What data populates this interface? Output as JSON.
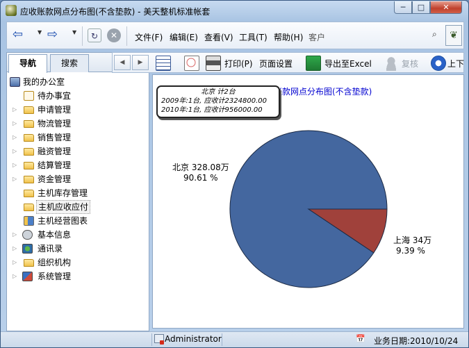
{
  "window": {
    "title": "应收账款网点分布图(不含垫款) - 美天整机标准帐套",
    "minimize_glyph": "─",
    "maximize_glyph": "□",
    "close_glyph": "✕"
  },
  "toolbar": {
    "menus": [
      {
        "label": "文件(F)"
      },
      {
        "label": "编辑(E)"
      },
      {
        "label": "查看(V)"
      },
      {
        "label": "工具(T)"
      },
      {
        "label": "帮助(H)"
      }
    ],
    "customer_label": "客户",
    "icons": {
      "back": "back-arrow-icon",
      "forward": "forward-arrow-icon",
      "refresh": "refresh-icon",
      "stop": "stop-icon",
      "search": "search-icon",
      "logo": "logo-icon"
    }
  },
  "left_panel": {
    "tabs": [
      {
        "label": "导航",
        "active": true
      },
      {
        "label": "搜索",
        "active": false
      }
    ],
    "tree": [
      {
        "label": "我的办公室",
        "level": 0,
        "icon": "office-icon",
        "expander": false
      },
      {
        "label": "待办事宜",
        "level": 1,
        "icon": "todo-icon",
        "expander": false
      },
      {
        "label": "申请管理",
        "level": 1,
        "icon": "folder-icon",
        "expander": true
      },
      {
        "label": "物流管理",
        "level": 1,
        "icon": "folder-icon",
        "expander": true
      },
      {
        "label": "销售管理",
        "level": 1,
        "icon": "folder-icon",
        "expander": true
      },
      {
        "label": "融资管理",
        "level": 1,
        "icon": "folder-icon",
        "expander": true
      },
      {
        "label": "结算管理",
        "level": 1,
        "icon": "folder-icon",
        "expander": true
      },
      {
        "label": "资金管理",
        "level": 1,
        "icon": "folder-icon",
        "expander": true
      },
      {
        "label": "主机库存管理",
        "level": 1,
        "icon": "folder-icon",
        "expander": false
      },
      {
        "label": "主机应收应付",
        "level": 1,
        "icon": "folder-icon",
        "expander": false,
        "selected": true
      },
      {
        "label": "主机经营图表",
        "level": 1,
        "icon": "chart-icon",
        "expander": false
      },
      {
        "label": "基本信息",
        "level": 0,
        "icon": "info-icon",
        "expander": true
      },
      {
        "label": "通讯录",
        "level": 0,
        "icon": "contacts-icon",
        "expander": true
      },
      {
        "label": "组织机构",
        "level": 0,
        "icon": "folder-icon",
        "expander": true
      },
      {
        "label": "系统管理",
        "level": 0,
        "icon": "system-icon",
        "expander": true
      }
    ]
  },
  "toolbar2": {
    "print_label": "打印(P)",
    "page_setup_label": "页面设置",
    "export_label": "导出至Excel",
    "review_label": "复核",
    "updown_label": "上下",
    "prev_glyph": "◀",
    "next_glyph": "▶"
  },
  "chart": {
    "title": "应收账款网点分布图(不含垫款)",
    "colors": {
      "北京": "#44679f",
      "上海": "#a0413b"
    },
    "tooltip": {
      "title": "北京 计2台",
      "lines": [
        "2009年:1台, 应收计2324800.00",
        "2010年:1台, 应收计956000.00"
      ]
    }
  },
  "chart_data": {
    "type": "pie",
    "title": "应收账款网点分布图(不含垫款)",
    "slices": [
      {
        "name": "北京",
        "value_label": "北京 328.08万",
        "percent_label": "90.61 %",
        "value": 328.08,
        "percent": 90.61
      },
      {
        "name": "上海",
        "value_label": "上海 34万",
        "percent_label": "9.39 %",
        "value": 34,
        "percent": 9.39
      }
    ]
  },
  "status": {
    "user": "Administrator",
    "date_label": "业务日期:2010/10/24"
  }
}
